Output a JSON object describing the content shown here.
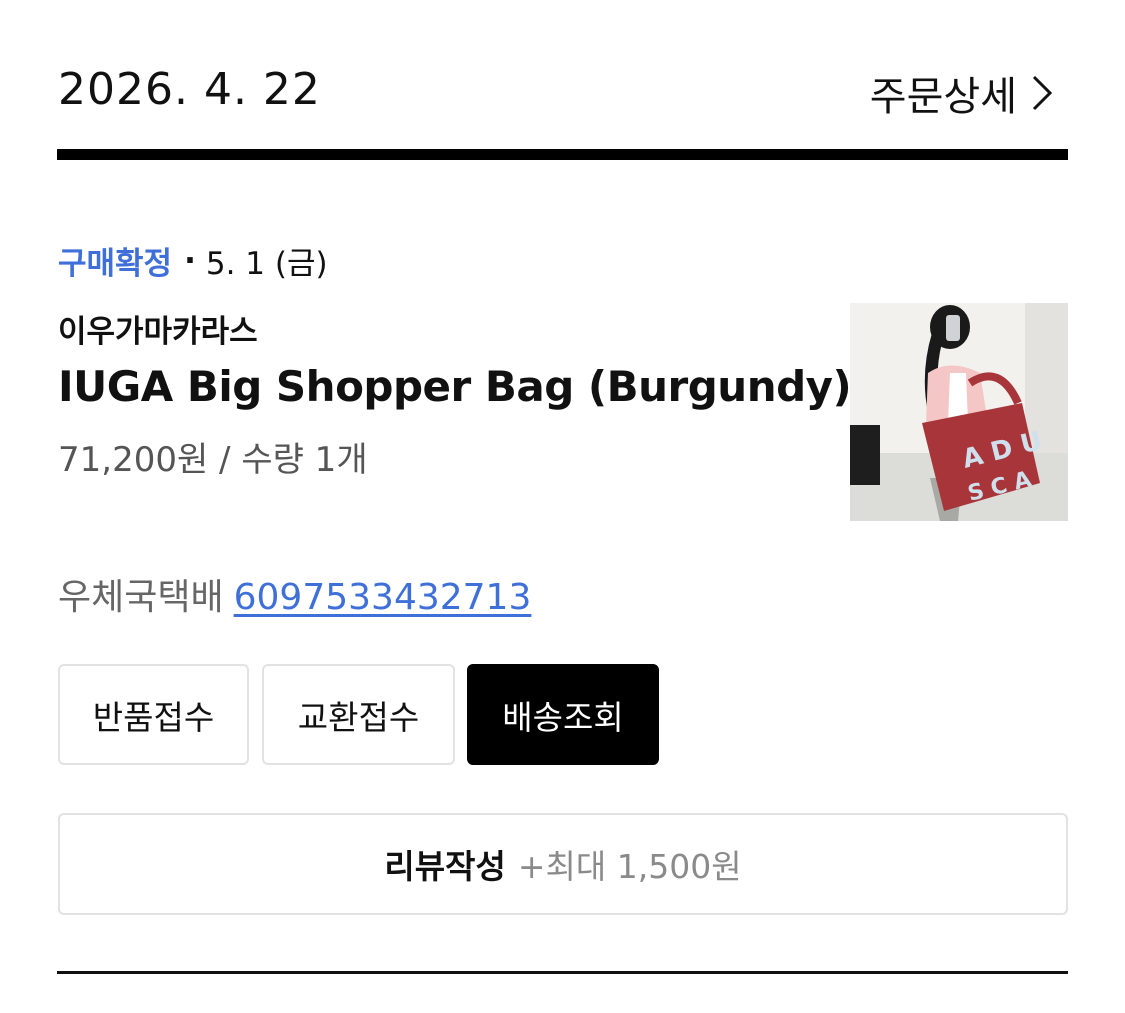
{
  "order": {
    "date": "2026. 4. 22",
    "detail_label": "주문상세"
  },
  "item": {
    "status": "구매확정",
    "separator": "·",
    "status_date": "5. 1 (금)",
    "brand": "이우가마카라스",
    "name": "IUGA Big Shopper Bag (Burgundy)",
    "price_qty": "71,200원 / 수량 1개",
    "thumbnail_icon": "product-photo"
  },
  "shipping": {
    "courier": "우체국택배",
    "tracking_number": "6097533432713"
  },
  "actions": {
    "return_label": "반품접수",
    "exchange_label": "교환접수",
    "track_label": "배송조회",
    "review_label": "리뷰작성",
    "review_reward": "+최대 1,500원"
  },
  "colors": {
    "accent_blue": "#3f6fd8",
    "primary_button": "#000000",
    "bag_burgundy": "#a8353a"
  }
}
